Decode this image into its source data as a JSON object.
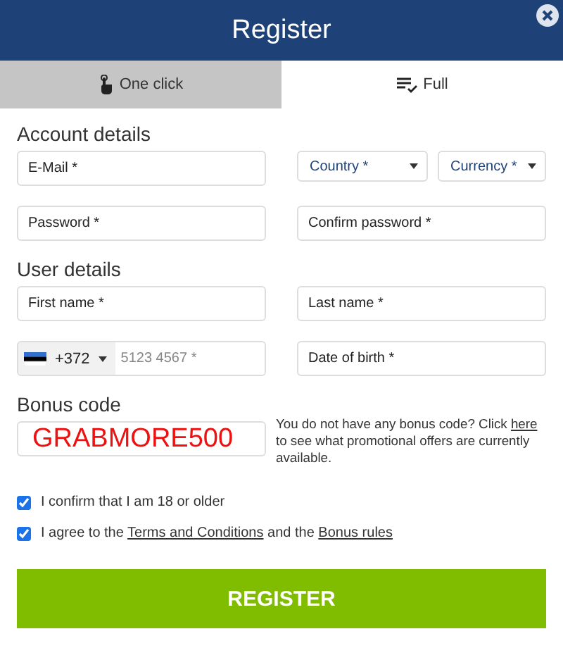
{
  "window": {
    "title": "Register"
  },
  "tabs": [
    {
      "label": "One click",
      "kind": "oneclick",
      "selected": false
    },
    {
      "label": "Full",
      "kind": "full",
      "selected": true
    }
  ],
  "account_details": {
    "title": "Account details",
    "email": {
      "placeholder": "E-Mail *"
    },
    "country": {
      "label": "Country *"
    },
    "currency": {
      "label": "Currency *"
    },
    "password": {
      "placeholder": "Password *"
    },
    "confirm_password": {
      "placeholder": "Confirm password *"
    }
  },
  "user_details": {
    "title": "User details",
    "first_name": {
      "placeholder": "First name *"
    },
    "last_name": {
      "placeholder": "Last name *"
    },
    "phone": {
      "code": "+372",
      "placeholder": "5123 4567 *"
    },
    "date_of_birth": {
      "placeholder": "Date of birth *"
    }
  },
  "bonus": {
    "title": "Bonus code",
    "value": "GRABMORE500",
    "hint_before": "You do not have any bonus code? Click ",
    "hint_link": "here",
    "hint_after": " to see what promotional offers are currently available."
  },
  "confirm_age": {
    "label": "I confirm that I am 18 or older",
    "checked": true
  },
  "agree": {
    "before": "I agree to the ",
    "terms_link": "Terms and Conditions",
    "middle": " and the ",
    "rules_link": "Bonus rules",
    "checked": true
  },
  "register_button": "REGISTER"
}
